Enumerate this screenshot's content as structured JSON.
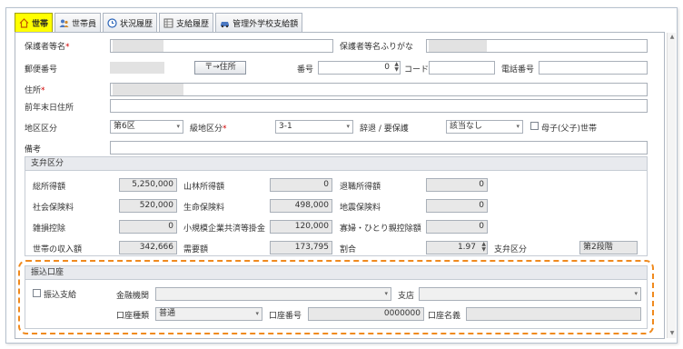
{
  "tabs": [
    {
      "label": "世帯",
      "icon": "home-icon"
    },
    {
      "label": "世帯員",
      "icon": "people-icon"
    },
    {
      "label": "状況履歴",
      "icon": "clock-icon"
    },
    {
      "label": "支給履歴",
      "icon": "table-icon"
    },
    {
      "label": "管理外学校支給額",
      "icon": "car-icon"
    }
  ],
  "form": {
    "guardian_name_label": "保護者等名",
    "guardian_name_required": "*",
    "guardian_kana_label": "保護者等名ふりがな",
    "postal_label": "郵便番号",
    "postal_button": "〒→住所",
    "number_label": "番号",
    "number_value": "0",
    "code_label": "コード",
    "phone_label": "電話番号",
    "address_label": "住所",
    "address_required": "*",
    "prev_address_label": "前年末日住所",
    "district_label": "地区区分",
    "district_value": "第6区",
    "class_label": "級地区分",
    "class_required": "*",
    "class_value": "3-1",
    "withdraw_label": "辞退 / 要保護",
    "withdraw_value": "該当なし",
    "single_parent_label": "母子(父子)世帯",
    "remarks_label": "備考"
  },
  "support": {
    "header": "支弁区分",
    "rows": [
      [
        {
          "label": "総所得額",
          "value": "5,250,000"
        },
        {
          "label": "山林所得額",
          "value": "0"
        },
        {
          "label": "退職所得額",
          "value": "0"
        }
      ],
      [
        {
          "label": "社会保険料",
          "value": "520,000"
        },
        {
          "label": "生命保険料",
          "value": "498,000"
        },
        {
          "label": "地震保険料",
          "value": "0"
        }
      ],
      [
        {
          "label": "雑損控除",
          "value": "0"
        },
        {
          "label": "小規模企業共済等掛金",
          "value": "120,000"
        },
        {
          "label": "寡婦・ひとり親控除額",
          "value": "0"
        }
      ],
      [
        {
          "label": "世帯の収入額",
          "value": "342,666"
        },
        {
          "label": "需要額",
          "value": "173,795"
        },
        {
          "label": "割合",
          "value": "1.97"
        }
      ]
    ],
    "category_label": "支弁区分",
    "category_value": "第2段階"
  },
  "bank": {
    "header": "振込口座",
    "transfer_label": "振込支給",
    "institution_label": "金融機関",
    "branch_label": "支店",
    "account_type_label": "口座種類",
    "account_type_value": "普通",
    "account_number_label": "口座番号",
    "account_number_value": "0000000",
    "account_name_label": "口座名義"
  },
  "colors": {
    "active_tab": "#ffff00",
    "highlight": "#f08a1e",
    "required": "#d00000"
  }
}
